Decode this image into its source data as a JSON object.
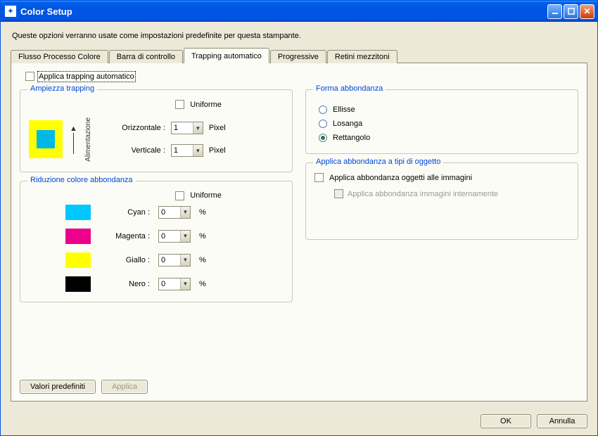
{
  "window": {
    "title": "Color Setup",
    "description": "Queste opzioni verranno usate come impostazioni predefinite per questa stampante."
  },
  "tabs": {
    "items": [
      {
        "label": "Flusso Processo Colore"
      },
      {
        "label": "Barra di controllo"
      },
      {
        "label": "Trapping automatico"
      },
      {
        "label": "Progressive"
      },
      {
        "label": "Retini mezzitoni"
      }
    ],
    "active_index": 2
  },
  "apply_trapping": {
    "label": "Applica trapping automatico",
    "checked": false
  },
  "ampiezza": {
    "legend": "Ampiezza trapping",
    "uniforme_label": "Uniforme",
    "uniforme_checked": false,
    "feed_label": "Alimentazione",
    "horizontal_label": "Orizzontale :",
    "horizontal_value": "1",
    "vertical_label": "Verticale :",
    "vertical_value": "1",
    "unit": "Pixel"
  },
  "forma": {
    "legend": "Forma abbondanza",
    "options": [
      {
        "label": "Ellisse",
        "checked": false
      },
      {
        "label": "Losanga",
        "checked": false
      },
      {
        "label": "Rettangolo",
        "checked": true
      }
    ]
  },
  "riduzione": {
    "legend": "Riduzione colore abbondanza",
    "uniforme_label": "Uniforme",
    "uniforme_checked": false,
    "rows": [
      {
        "color": "cyan",
        "label": "Cyan :",
        "value": "0",
        "unit": "%"
      },
      {
        "color": "magenta",
        "label": "Magenta :",
        "value": "0",
        "unit": "%"
      },
      {
        "color": "yellow",
        "label": "Giallo :",
        "value": "0",
        "unit": "%"
      },
      {
        "color": "black",
        "label": "Nero :",
        "value": "0",
        "unit": "%"
      }
    ]
  },
  "apply_obj": {
    "legend": "Applica abbondanza a tipi di oggetto",
    "opt1_label": "Applica abbondanza oggetti alle immagini",
    "opt1_checked": false,
    "opt2_label": "Applica abbondanza immagini internamente",
    "opt2_enabled": false
  },
  "buttons": {
    "defaults": "Valori predefiniti",
    "apply": "Applica",
    "ok": "OK",
    "cancel": "Annulla"
  }
}
